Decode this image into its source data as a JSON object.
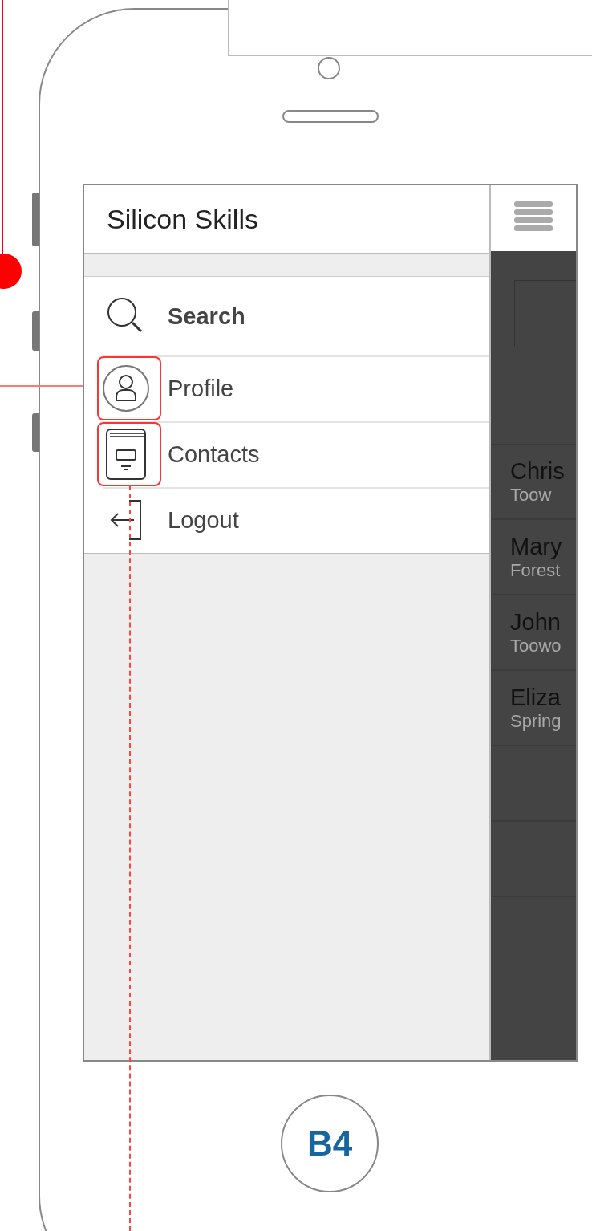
{
  "app": {
    "title": "Silicon Skills"
  },
  "menu": [
    {
      "label": "Search",
      "kind": "search",
      "selected": true,
      "annotated": false
    },
    {
      "label": "Profile",
      "kind": "profile",
      "selected": false,
      "annotated": true
    },
    {
      "label": "Contacts",
      "kind": "contacts",
      "selected": false,
      "annotated": true
    },
    {
      "label": "Logout",
      "kind": "logout",
      "selected": false,
      "annotated": false
    }
  ],
  "contacts": [
    {
      "name": "Chris",
      "place": "Toow"
    },
    {
      "name": "Mary",
      "place": "Forest"
    },
    {
      "name": "John",
      "place": "Toowo"
    },
    {
      "name": "Eliza",
      "place": "Spring"
    }
  ],
  "home_button": {
    "label": "B4"
  }
}
